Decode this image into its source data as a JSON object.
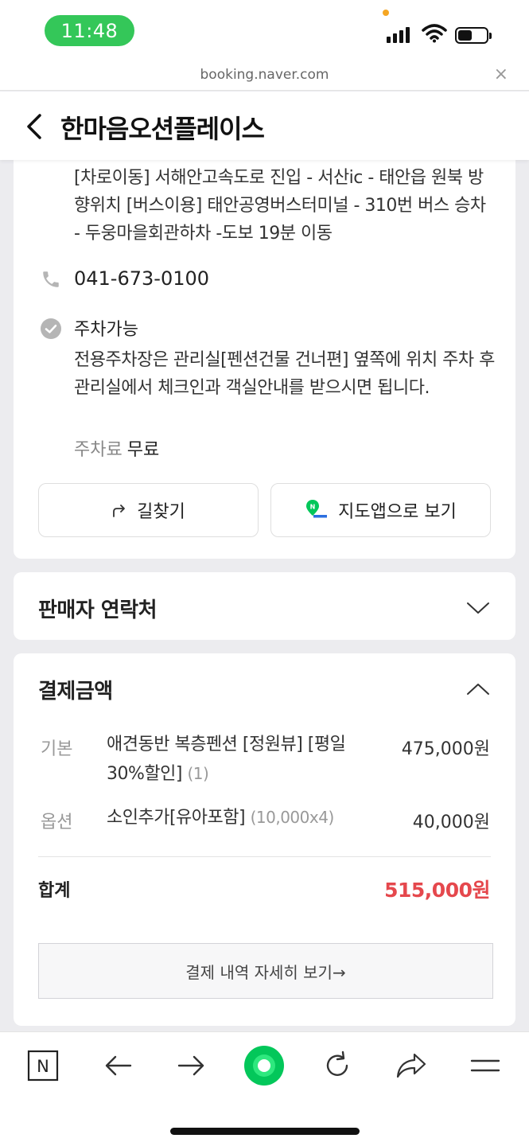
{
  "status_bar": {
    "time": "11:48",
    "battery_level": 0.5
  },
  "url_bar": {
    "url": "booking.naver.com",
    "close_label": "×"
  },
  "header": {
    "title": "한마음오션플레이스"
  },
  "info": {
    "directions": "[차로이동] 서해안고속도로 진입 - 서산ic - 태안읍 원북 방향위치 [버스이용] 태안공영버스터미널 - 310번 버스 승차 - 두웅마을회관하차 -도보 19분 이동",
    "phone": "041-673-0100",
    "parking_title": "주차가능",
    "parking_desc": "전용주차장은 관리실[펜션건물 건너편] 옆쪽에 위치 주차 후 관리실에서 체크인과 객실안내를 받으시면 됩니다.",
    "fee_label": "주차료",
    "fee_value": "무료",
    "route_button": "길찾기",
    "map_button": "지도앱으로 보기"
  },
  "seller": {
    "title": "판매자 연락처"
  },
  "payment": {
    "title": "결제금액",
    "items": [
      {
        "label": "기본",
        "desc": "애견동반 복층펜션 [정원뷰] [평일 30%할인]",
        "note": "(1)",
        "amount": "475,000원"
      },
      {
        "label": "옵션",
        "desc": "소인추가[유아포함]",
        "note": "(10,000x4)",
        "amount": "40,000원"
      }
    ],
    "total_label": "합계",
    "total_amount": "515,000원",
    "detail_button": "결제 내역 자세히 보기→"
  },
  "toolbar": {
    "naver_logo": "N"
  },
  "colors": {
    "accent_green": "#03c75a",
    "total_red": "#e5484d",
    "status_green": "#34c759"
  }
}
